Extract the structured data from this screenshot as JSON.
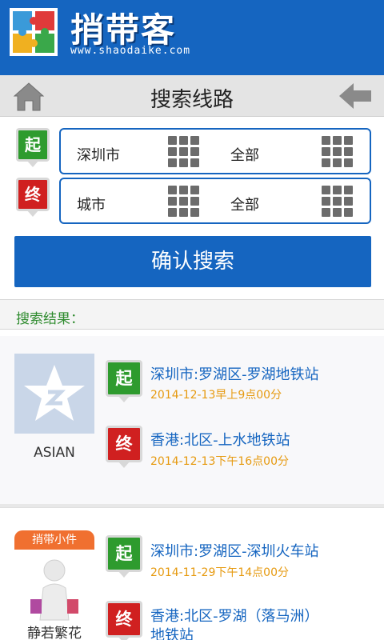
{
  "brand": {
    "name": "捎带客",
    "url": "www.shaodaike.com"
  },
  "titlebar": {
    "title": "搜索线路"
  },
  "search": {
    "start": {
      "marker": "起",
      "city": "深圳市",
      "district": "全部"
    },
    "end": {
      "marker": "终",
      "city": "城市",
      "district": "全部"
    },
    "confirm_label": "确认搜索"
  },
  "results": {
    "header": "搜索结果：",
    "items": [
      {
        "avatar_label": "ASIAN",
        "start_marker": "起",
        "start_route": "深圳市:罗湖区-罗湖地铁站",
        "start_time": "2014-12-13早上9点00分",
        "end_marker": "终",
        "end_route": "香港:北区-上水地铁站",
        "end_time": "2014-12-13下午16点00分"
      },
      {
        "badge": "捎带小件",
        "avatar_label": "静若繁花",
        "start_marker": "起",
        "start_route": "深圳市:罗湖区-深圳火车站",
        "start_time": "2014-11-29下午14点00分",
        "end_marker": "终",
        "end_route": "香港:北区-罗湖（落马洲）",
        "end_route_line2": "地铁站"
      }
    ]
  },
  "colors": {
    "primary": "#1565c0",
    "start_green": "#2e9b2e",
    "end_red": "#d02020",
    "time_orange": "#e69a10"
  }
}
